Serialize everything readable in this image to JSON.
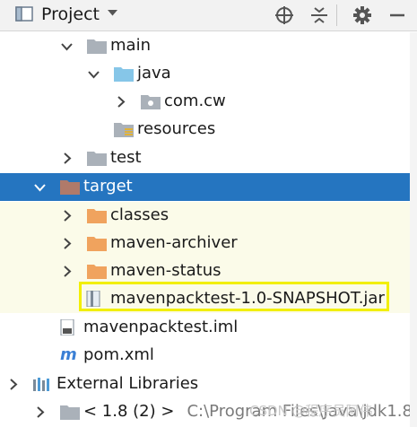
{
  "header": {
    "title": "Project",
    "icons": [
      "project-view-icon",
      "dropdown-icon",
      "locate-icon",
      "collapse-all-icon",
      "settings-icon",
      "hide-icon"
    ]
  },
  "tree": [
    {
      "label": "main",
      "expanded": true,
      "icon": "folder"
    },
    {
      "label": "java",
      "expanded": true,
      "icon": "source-folder"
    },
    {
      "label": "com.cw",
      "expanded": false,
      "icon": "package"
    },
    {
      "label": "resources",
      "icon": "resources-folder"
    },
    {
      "label": "test",
      "expanded": false,
      "icon": "folder"
    },
    {
      "label": "target",
      "expanded": true,
      "selected": true,
      "icon": "excluded-folder"
    },
    {
      "label": "classes",
      "expanded": false,
      "icon": "orange-folder"
    },
    {
      "label": "maven-archiver",
      "expanded": false,
      "icon": "orange-folder"
    },
    {
      "label": "maven-status",
      "expanded": false,
      "icon": "orange-folder"
    },
    {
      "label": "mavenpacktest-1.0-SNAPSHOT.jar",
      "icon": "jar-file",
      "highlighted": true
    },
    {
      "label": "mavenpacktest.iml",
      "icon": "iml-file"
    },
    {
      "label": "pom.xml",
      "icon": "maven-file"
    },
    {
      "label": "External Libraries",
      "expanded": false,
      "icon": "libraries"
    },
    {
      "label": "< 1.8 (2) >",
      "path": "C:\\Program Files\\Java\\jdk1.8",
      "expanded": false,
      "icon": "jdk-folder"
    }
  ],
  "watermark": "CSDN @程序员阿伟",
  "colors": {
    "selection": "#2575c0",
    "tint": "#fbfbe9",
    "highlight_box": "#f2ef00",
    "orange_folder": "#f0a35e"
  }
}
